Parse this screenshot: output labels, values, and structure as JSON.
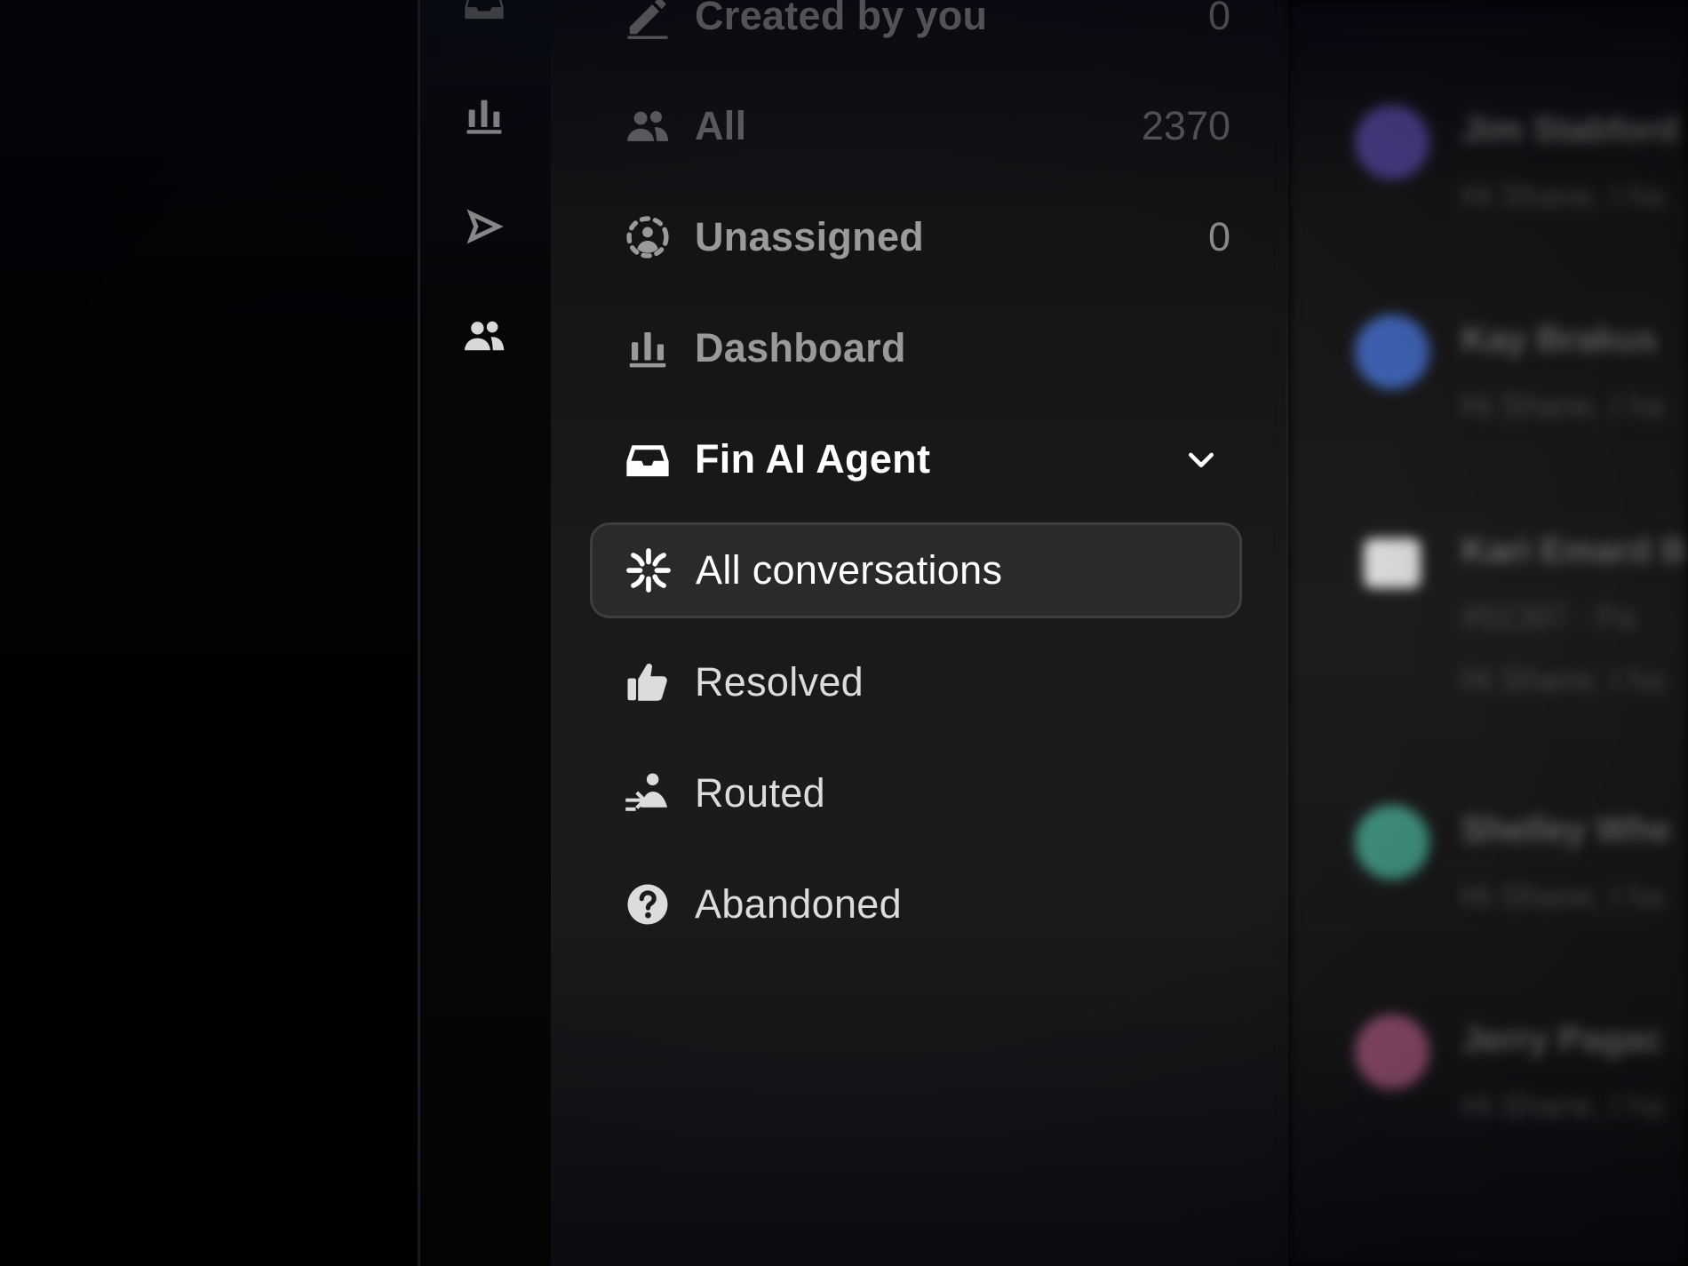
{
  "rail": {
    "icons": [
      "inbox-icon",
      "reports-bar-chart-icon",
      "outbound-send-icon",
      "contacts-people-icon"
    ]
  },
  "nav": {
    "created_by_you": {
      "label": "Created by you",
      "count": "0",
      "icon": "pencil-icon"
    },
    "all": {
      "label": "All",
      "count": "2370",
      "icon": "people-icon"
    },
    "unassigned": {
      "label": "Unassigned",
      "count": "0",
      "icon": "unassigned-person-icon"
    },
    "dashboard": {
      "label": "Dashboard",
      "icon": "bar-chart-icon"
    },
    "fin_ai_agent": {
      "label": "Fin AI Agent",
      "icon": "inbox-tray-icon",
      "expanded": true
    },
    "sub_items": [
      {
        "label": "All conversations",
        "icon": "fin-burst-icon",
        "active": true
      },
      {
        "label": "Resolved",
        "icon": "thumbs-up-icon"
      },
      {
        "label": "Routed",
        "icon": "routed-person-icon"
      },
      {
        "label": "Abandoned",
        "icon": "question-circle-icon"
      }
    ]
  },
  "conversations": [
    {
      "name": "Jim Stabford",
      "line1": "Hi Shane, I ha",
      "avatar_color": "#4a3f8a"
    },
    {
      "name": "Kay Brakus",
      "line1": "Hi Shane, I ha",
      "avatar_color": "#3f63b5"
    },
    {
      "name": "Kari Emard B",
      "line1": "#51397 · Pa",
      "line2": "Hi Shane, I ha",
      "avatar_color": "#d8d8d8"
    },
    {
      "name": "Shelley Whe",
      "line1": "Hi Shane, I ha",
      "avatar_color": "#3f8f7c"
    },
    {
      "name": "Jerry Pagac",
      "line1": "Hi Shane, I ha",
      "avatar_color": "#8a4a6a"
    }
  ]
}
